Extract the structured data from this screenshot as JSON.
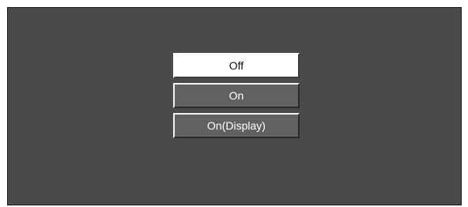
{
  "menu": {
    "options": [
      {
        "label": "Off",
        "selected": true
      },
      {
        "label": "On",
        "selected": false
      },
      {
        "label": "On(Display)",
        "selected": false
      }
    ]
  },
  "colors": {
    "screen_background": "#4a4a4a",
    "option_background": "#616161",
    "selected_background": "#ffffff",
    "option_text": "#ffffff",
    "selected_text": "#111111"
  }
}
